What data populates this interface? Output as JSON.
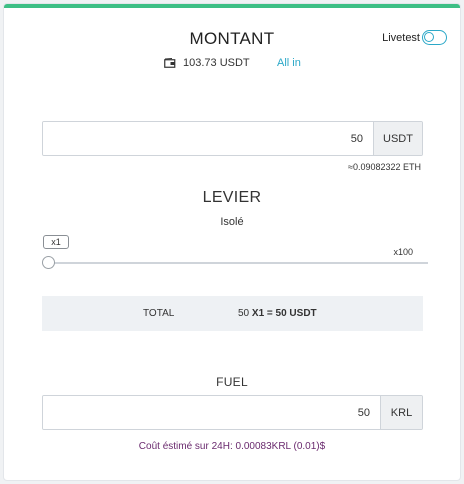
{
  "header": {
    "title": "MONTANT",
    "livetest_label": "Livetest",
    "livetest_on": false
  },
  "balance": {
    "amount": "103.73 USDT",
    "allin_label": "All in"
  },
  "montant": {
    "value": "50",
    "unit": "USDT",
    "eth_equivalent": "≈0.09082322 ETH"
  },
  "levier": {
    "title": "LEVIER",
    "mode": "Isolé",
    "current_badge": "x1",
    "max_label": "x100",
    "level_fraction": 0
  },
  "total": {
    "label": "TOTAL",
    "amount": "50",
    "multiplier_expression": "X1 = 50 USDT"
  },
  "fuel": {
    "title": "FUEL",
    "value": "50",
    "unit": "KRL",
    "cost_text": "Coût éstimé sur 24H: 0.00083KRL (0.01)$"
  },
  "colors": {
    "accent_green": "#3dbf85",
    "link_blue": "#2ba8c8",
    "cost_purple": "#6a2a6e"
  },
  "icons": {
    "balance": "wallet-icon"
  }
}
